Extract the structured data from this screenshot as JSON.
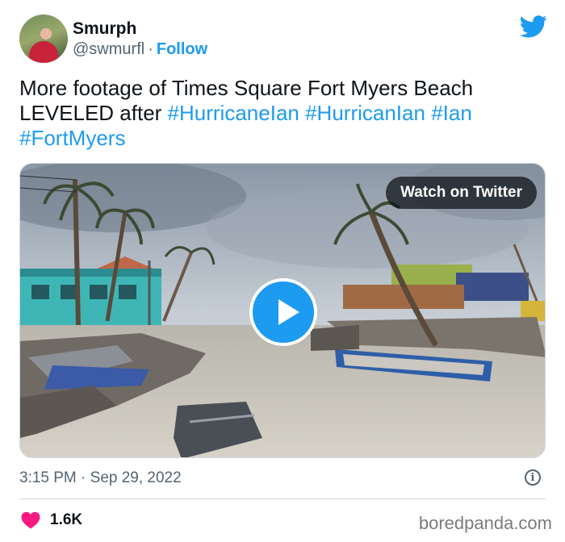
{
  "author": {
    "name": "Smurph",
    "handle": "@swmurfl",
    "separator": "·",
    "follow_label": "Follow"
  },
  "tweet": {
    "text_plain": "More footage of Times Square Fort Myers Beach LEVELED after",
    "hashtags": [
      "#HurricaneIan",
      "#HurricanIan",
      "#Ian",
      "#FortMyers"
    ]
  },
  "media": {
    "watch_label": "Watch on Twitter",
    "play_icon": "play-icon"
  },
  "meta": {
    "timestamp": "3:15 PM · Sep 29, 2022",
    "info_icon_glyph": "i"
  },
  "engagement": {
    "likes": "1.6K",
    "heart_color": "#f91880"
  },
  "watermark": "boredpanda.com",
  "colors": {
    "accent": "#1d9bf0",
    "text": "#0f1419",
    "muted": "#536471"
  }
}
